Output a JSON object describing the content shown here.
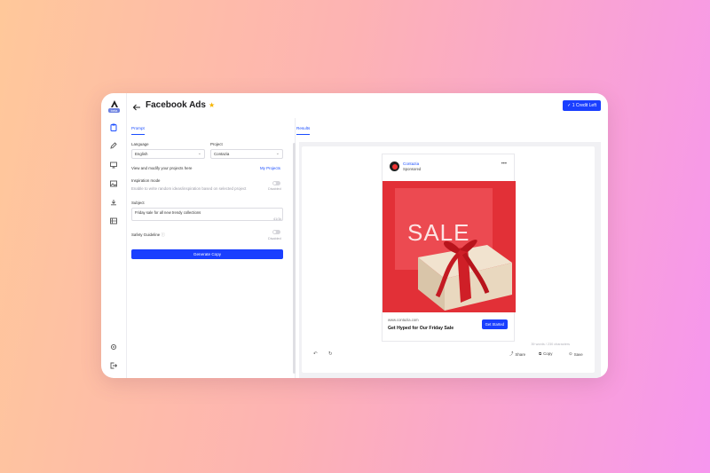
{
  "app": {
    "title": "Facebook Ads",
    "credit_label": "1 Credit Left",
    "logo_badge": "beta"
  },
  "left": {
    "tab": "Prompt",
    "language_label": "Language",
    "language_value": "English",
    "project_label": "Project",
    "project_value": "Contazia",
    "info_text": "View and modify your projects here",
    "my_projects": "My Projects",
    "inspiration_label": "Inspiration mode",
    "inspiration_desc": "Enable to write random ideas/inspiration based on selected project",
    "inspiration_state": "Disabled",
    "subject_label": "Subject",
    "subject_value": "Friday sale for all new trendy collections",
    "subject_count": "41/1k",
    "safety_label": "Safety Guideline",
    "safety_state": "Disabled",
    "generate_label": "Generate Copy"
  },
  "right": {
    "tab": "Results",
    "ad": {
      "brand": "Contazia",
      "sponsored": "Sponsored",
      "image_text": "SALE",
      "url": "www.contazia.com",
      "headline": "Get Hyped for Our Friday Sale",
      "cta": "Get Started"
    },
    "counter": "39 words / 230 characters",
    "actions": {
      "share": "Share",
      "copy": "Copy",
      "save": "Save"
    }
  },
  "colors": {
    "accent": "#1a3fff",
    "star": "#f5b400",
    "ad_red": "#e13138"
  },
  "icons": [
    "logo-icon",
    "clipboard-icon",
    "pencil-icon",
    "monitor-icon",
    "image-icon",
    "download-icon",
    "storage-icon",
    "settings-icon",
    "logout-icon",
    "back-arrow-icon",
    "star-icon",
    "check-icon",
    "chevron-down-icon",
    "info-icon",
    "more-icon",
    "undo-icon",
    "refresh-icon",
    "share-icon",
    "copy-icon",
    "save-icon"
  ]
}
